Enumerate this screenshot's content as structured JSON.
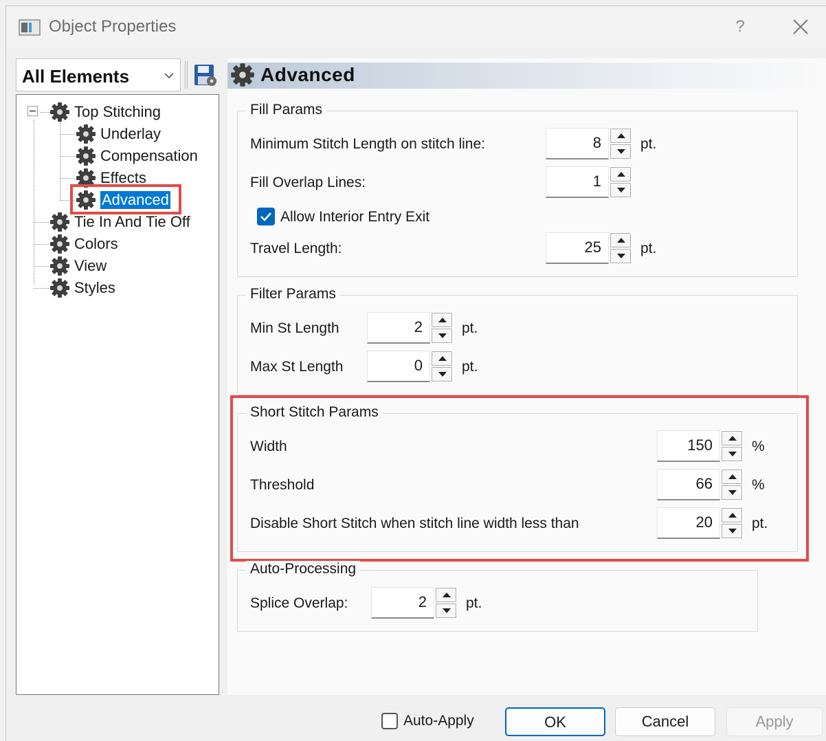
{
  "window": {
    "title": "Object Properties",
    "help_label": "?",
    "close_label": "×"
  },
  "left": {
    "filter_label": "All Elements",
    "tree": [
      {
        "label": "Top Stitching"
      },
      {
        "label": "Underlay"
      },
      {
        "label": "Compensation"
      },
      {
        "label": "Effects"
      },
      {
        "label": "Advanced",
        "selected": true
      },
      {
        "label": "Tie In And Tie Off"
      },
      {
        "label": "Colors"
      },
      {
        "label": "View"
      },
      {
        "label": "Styles"
      }
    ]
  },
  "panel": {
    "title": "Advanced",
    "fill_params": {
      "title": "Fill Params",
      "min_stitch_label": "Minimum Stitch Length on stitch line:",
      "min_stitch_value": "8",
      "min_stitch_unit": "pt.",
      "overlap_label": "Fill Overlap Lines:",
      "overlap_value": "1",
      "allow_entry_label": "Allow Interior Entry Exit",
      "allow_entry_checked": true,
      "travel_label": "Travel Length:",
      "travel_value": "25",
      "travel_unit": "pt."
    },
    "filter_params": {
      "title": "Filter Params",
      "min_label": "Min St Length",
      "min_value": "2",
      "min_unit": "pt.",
      "max_label": "Max St Length",
      "max_value": "0",
      "max_unit": "pt."
    },
    "short_stitch": {
      "title": "Short Stitch Params",
      "width_label": "Width",
      "width_value": "150",
      "width_unit": "%",
      "threshold_label": "Threshold",
      "threshold_value": "66",
      "threshold_unit": "%",
      "disable_label": "Disable Short Stitch when stitch line width less than",
      "disable_value": "20",
      "disable_unit": "pt."
    },
    "auto_processing": {
      "title": "Auto-Processing",
      "splice_label": "Splice Overlap:",
      "splice_value": "2",
      "splice_unit": "pt."
    }
  },
  "footer": {
    "auto_apply_label": "Auto-Apply",
    "auto_apply_checked": false,
    "ok_label": "OK",
    "cancel_label": "Cancel",
    "apply_label": "Apply"
  },
  "colors": {
    "highlight": "#e24a4a",
    "selection": "#0078d7",
    "accent": "#0067c0"
  }
}
